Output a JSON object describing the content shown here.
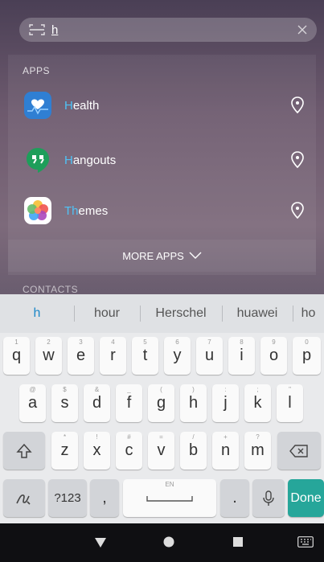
{
  "search": {
    "query": "h"
  },
  "apps_section": {
    "header": "APPS",
    "items": [
      {
        "highlight": "H",
        "rest": "ealth",
        "icon": "health-icon",
        "color": "#2f7fd3"
      },
      {
        "highlight": "H",
        "rest": "angouts",
        "icon": "hangouts-icon",
        "color": "#1e9e5a"
      },
      {
        "highlight": "Th",
        "rest": "emes",
        "icon": "themes-icon",
        "color": "#ffffff"
      }
    ],
    "more_label": "MORE APPS"
  },
  "contacts_section": {
    "header": "CONTACTS"
  },
  "keyboard": {
    "suggestions": [
      "h",
      "hour",
      "Herschel",
      "huawei",
      "ho"
    ],
    "row1": [
      {
        "k": "q",
        "s": "1"
      },
      {
        "k": "w",
        "s": "2"
      },
      {
        "k": "e",
        "s": "3"
      },
      {
        "k": "r",
        "s": "4"
      },
      {
        "k": "t",
        "s": "5"
      },
      {
        "k": "y",
        "s": "6"
      },
      {
        "k": "u",
        "s": "7"
      },
      {
        "k": "i",
        "s": "8"
      },
      {
        "k": "o",
        "s": "9"
      },
      {
        "k": "p",
        "s": "0"
      }
    ],
    "row2": [
      {
        "k": "a",
        "s": "@"
      },
      {
        "k": "s",
        "s": "$"
      },
      {
        "k": "d",
        "s": "&"
      },
      {
        "k": "f",
        "s": "_"
      },
      {
        "k": "g",
        "s": "("
      },
      {
        "k": "h",
        "s": ")"
      },
      {
        "k": "j",
        "s": ":"
      },
      {
        "k": "k",
        "s": ";"
      },
      {
        "k": "l",
        "s": "\""
      }
    ],
    "row3": [
      {
        "k": "z",
        "s": "*"
      },
      {
        "k": "x",
        "s": "!"
      },
      {
        "k": "c",
        "s": "#"
      },
      {
        "k": "v",
        "s": "="
      },
      {
        "k": "b",
        "s": "/"
      },
      {
        "k": "n",
        "s": "+"
      },
      {
        "k": "m",
        "s": "?"
      }
    ],
    "symbols_label": "?123",
    "comma_label": ",",
    "space_hint": "EN",
    "period_label": ".",
    "done_label": "Done"
  },
  "colors": {
    "accent": "#4fc3f7",
    "done_key": "#26a69a"
  }
}
